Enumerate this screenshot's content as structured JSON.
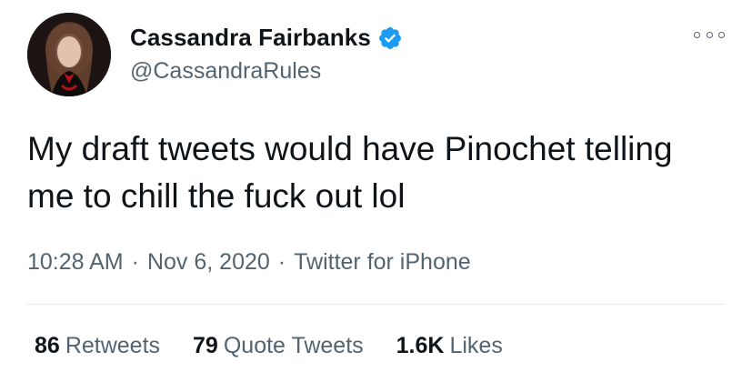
{
  "author": {
    "display_name": "Cassandra Fairbanks",
    "handle": "@CassandraRules",
    "verified": true,
    "verified_color": "#1d9bf0"
  },
  "menu": {
    "icon": "more-options-icon"
  },
  "tweet": {
    "text": "My draft tweets would have Pinochet telling me to chill the fuck out lol",
    "time": "10:28 AM",
    "date": "Nov 6, 2020",
    "source": "Twitter for iPhone",
    "separator": "·"
  },
  "stats": {
    "retweets_count": "86",
    "retweets_label": "Retweets",
    "quotes_count": "79",
    "quotes_label": "Quote Tweets",
    "likes_count": "1.6K",
    "likes_label": "Likes"
  }
}
